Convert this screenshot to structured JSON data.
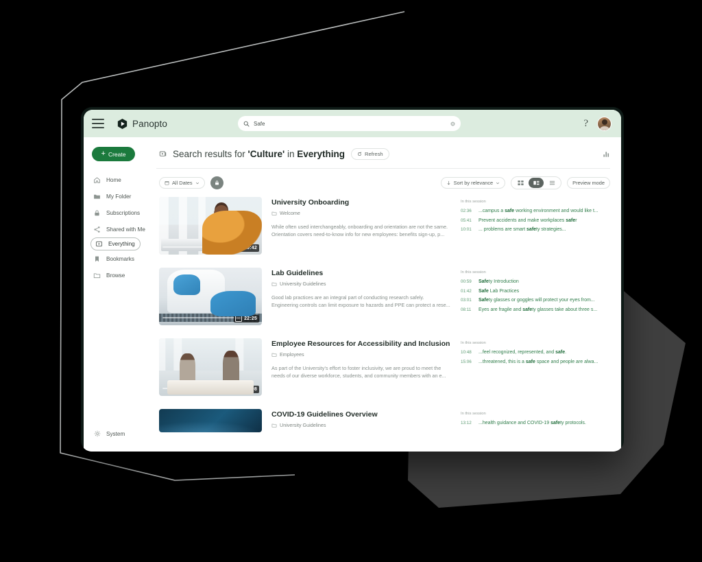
{
  "topbar": {
    "menu_icon": "hamburger-menu-icon",
    "brand_name": "Panopto",
    "brand_icon": "panopto-logo-icon",
    "search": {
      "value": "Safe",
      "placeholder": "Search",
      "search_icon": "search-icon",
      "clear_icon": "clear-circle-icon"
    },
    "help_label": "?",
    "avatar_name": "user-avatar"
  },
  "sidebar": {
    "create_label": "Create",
    "items": [
      {
        "label": "Home",
        "icon": "home-icon",
        "active": false
      },
      {
        "label": "My Folder",
        "icon": "folder-filled-icon",
        "active": false
      },
      {
        "label": "Subscriptions",
        "icon": "lock-icon",
        "active": false
      },
      {
        "label": "Shared with Me",
        "icon": "share-icon",
        "active": false
      },
      {
        "label": "Everything",
        "icon": "everything-icon",
        "active": true
      },
      {
        "label": "Bookmarks",
        "icon": "bookmark-icon",
        "active": false
      },
      {
        "label": "Browse",
        "icon": "folder-outline-icon",
        "active": false
      }
    ],
    "bottom_item": {
      "label": "System",
      "icon": "gear-icon"
    }
  },
  "results_header": {
    "icon": "video-results-icon",
    "prefix": "Search results for ",
    "query": "'Culture'",
    "middle": " in ",
    "scope": "Everything",
    "refresh_label": "Refresh",
    "refresh_icon": "refresh-icon",
    "analytics_icon": "bar-chart-icon"
  },
  "toolbar": {
    "date_filter": {
      "label": "All Dates",
      "icon": "calendar-icon",
      "chevron": "chevron-down-icon"
    },
    "lock_filter_icon": "lock-filled-icon",
    "sort": {
      "label": "Sort by relevance",
      "icon": "sort-down-arrow-icon",
      "chevron": "chevron-down-icon"
    },
    "views": [
      {
        "name": "grid-view",
        "icon": "grid-view-icon",
        "active": false
      },
      {
        "name": "card-view",
        "icon": "card-view-icon",
        "active": true
      },
      {
        "name": "list-view",
        "icon": "list-view-icon",
        "active": false
      }
    ],
    "preview_mode_label": "Preview mode"
  },
  "session_label": "In this session",
  "results": [
    {
      "title": "University Onboarding",
      "folder": "Welcome",
      "duration": "10:42",
      "cc": "CC",
      "description": "While often used interchangeably, onboarding and orientation are not the same. Orientation covers need-to-know info for new employees: benefits sign-up, p...",
      "art": "art1",
      "hits": [
        {
          "time": "02:36",
          "pre": "...campus a ",
          "hl": "safe",
          "post": " working environment and would like t..."
        },
        {
          "time": "05:41",
          "pre": "Prevent accidents and make workplaces ",
          "hl": "safe",
          "post": "r"
        },
        {
          "time": "10:01",
          "pre": "... problems are smart ",
          "hl": "safe",
          "post": "ty strategies..."
        }
      ]
    },
    {
      "title": "Lab Guidelines",
      "folder": "University Guidelines",
      "duration": "22:25",
      "cc": "CC",
      "description": "Good lab practices are an integral part of conducting research safely. Engineering controls can limit exposure to hazards and PPE can protect a rese...",
      "art": "art2",
      "hits": [
        {
          "time": "00:59",
          "pre": "",
          "hl": "Safe",
          "post": "ty Introduction"
        },
        {
          "time": "01:42",
          "pre": "",
          "hl": "Safe",
          "post": " Lab Practices"
        },
        {
          "time": "03:01",
          "pre": "",
          "hl": "Safe",
          "post": "ty glasses or goggles will protect your eyes from..."
        },
        {
          "time": "08:11",
          "pre": "Eyes are fragile and ",
          "hl": "safe",
          "post": "ty glasses take about three s..."
        }
      ]
    },
    {
      "title": "Employee Resources for Accessibility and Inclusion",
      "folder": "Employees",
      "duration": "16:08",
      "cc": "CC",
      "description": "As part of the University's effort to foster inclusivity, we are proud to meet the needs of our diverse workforce, students, and community members with an e...",
      "art": "art3",
      "hits": [
        {
          "time": "10:48",
          "pre": "...feel recognized, represented, and ",
          "hl": "safe",
          "post": "."
        },
        {
          "time": "15:06",
          "pre": "...threatened, this is a ",
          "hl": "safe",
          "post": " space and people are alwa..."
        }
      ]
    },
    {
      "title": "COVID-19 Guidelines Overview",
      "folder": "University Guidelines",
      "duration": "",
      "cc": "CC",
      "description": "",
      "art": "art4",
      "hits": [
        {
          "time": "13:12",
          "pre": "...health guidance and COVID-19 ",
          "hl": "safe",
          "post": "ty protocols."
        }
      ]
    }
  ],
  "colors": {
    "brand_green": "#1b7a3d",
    "header_green": "#dcecdf",
    "hit_green": "#2f7d4a",
    "canvas_black": "#000000",
    "shape_gray": "#3f3f3f",
    "outline_gray": "#b9bcbc"
  }
}
